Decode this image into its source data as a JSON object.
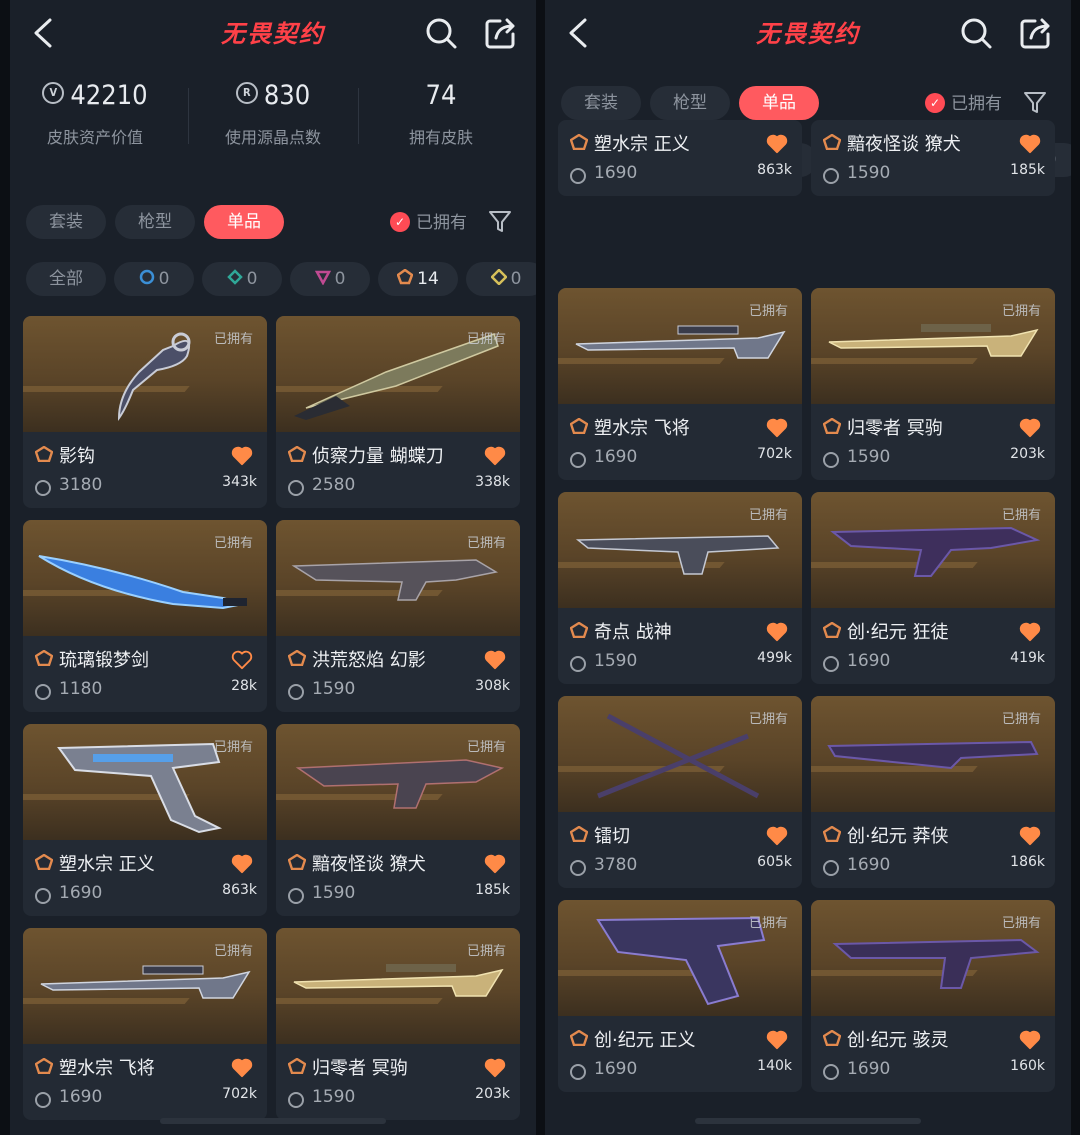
{
  "app_title": "无畏契约",
  "stats": [
    {
      "value": "42210",
      "label": "皮肤资产价值"
    },
    {
      "value": "830",
      "label": "使用源晶点数"
    },
    {
      "value": "74",
      "label": "拥有皮肤"
    }
  ],
  "tabs": [
    "套装",
    "枪型",
    "单品"
  ],
  "active_tab": "单品",
  "owned_filter_label": "已拥有",
  "rarity_chips": [
    {
      "label": "全部"
    },
    {
      "label": "0",
      "icon": "select-gem-icon",
      "color": "#3b8fd6"
    },
    {
      "label": "0",
      "icon": "deluxe-gem-icon",
      "color": "#2fa898"
    },
    {
      "label": "0",
      "icon": "premium-gem-icon",
      "color": "#c04a92"
    },
    {
      "label": "14",
      "icon": "exclusive-gem-icon",
      "color": "#e38a4e"
    },
    {
      "label": "0",
      "icon": "ultra-gem-icon",
      "color": "#d6c05a"
    }
  ],
  "owned_badge": "已拥有",
  "left_cards": [
    {
      "name": "影钩",
      "price": "3180",
      "likes": "343k",
      "heart": "filled",
      "art": "karambit-knife"
    },
    {
      "name": "侦察力量 蝴蝶刀",
      "price": "2580",
      "likes": "338k",
      "heart": "filled",
      "art": "butterfly-knife"
    },
    {
      "name": "琉璃锻梦剑",
      "price": "1180",
      "likes": "28k",
      "heart": "outline",
      "art": "blue-sword"
    },
    {
      "name": "洪荒怒焰 幻影",
      "price": "1590",
      "likes": "308k",
      "heart": "filled",
      "art": "phantom-rifle"
    },
    {
      "name": "塑水宗 正义",
      "price": "1690",
      "likes": "863k",
      "heart": "filled",
      "art": "sheriff-pistol"
    },
    {
      "name": "黯夜怪谈 獠犬",
      "price": "1590",
      "likes": "185k",
      "heart": "filled",
      "art": "bulldog-rifle"
    },
    {
      "name": "塑水宗 飞将",
      "price": "1690",
      "likes": "702k",
      "heart": "filled",
      "art": "sniper-rifle"
    },
    {
      "name": "归零者 冥驹",
      "price": "1590",
      "likes": "203k",
      "heart": "filled",
      "art": "gold-sniper"
    }
  ],
  "right_cards": [
    {
      "name": "塑水宗 正义",
      "price": "1690",
      "likes": "863k",
      "heart": "filled",
      "art": "sheriff-pistol"
    },
    {
      "name": "黯夜怪谈 獠犬",
      "price": "1590",
      "likes": "185k",
      "heart": "filled",
      "art": "bulldog-rifle"
    },
    {
      "name": "塑水宗 飞将",
      "price": "1690",
      "likes": "702k",
      "heart": "filled",
      "art": "sniper-rifle"
    },
    {
      "name": "归零者 冥驹",
      "price": "1590",
      "likes": "203k",
      "heart": "filled",
      "art": "gold-sniper"
    },
    {
      "name": "奇点 战神",
      "price": "1590",
      "likes": "499k",
      "heart": "filled",
      "art": "odin-lmg"
    },
    {
      "name": "创·纪元 狂徒",
      "price": "1690",
      "likes": "419k",
      "heart": "filled",
      "art": "vandal-rifle"
    },
    {
      "name": "镭切",
      "price": "3780",
      "likes": "605k",
      "heart": "filled",
      "art": "dual-katanas"
    },
    {
      "name": "创·纪元 莽侠",
      "price": "1690",
      "likes": "186k",
      "heart": "filled",
      "art": "bucky-shotgun"
    },
    {
      "name": "创·纪元 正义",
      "price": "1690",
      "likes": "140k",
      "heart": "filled",
      "art": "sheriff-revolver"
    },
    {
      "name": "创·纪元 骇灵",
      "price": "1690",
      "likes": "160k",
      "heart": "filled",
      "art": "spectre-smg"
    }
  ],
  "colors": {
    "accent": "#ff5a5f",
    "heart": "#ff8a47",
    "title": "#ff4148",
    "card": "#232a34",
    "panel": "#1a2029"
  }
}
